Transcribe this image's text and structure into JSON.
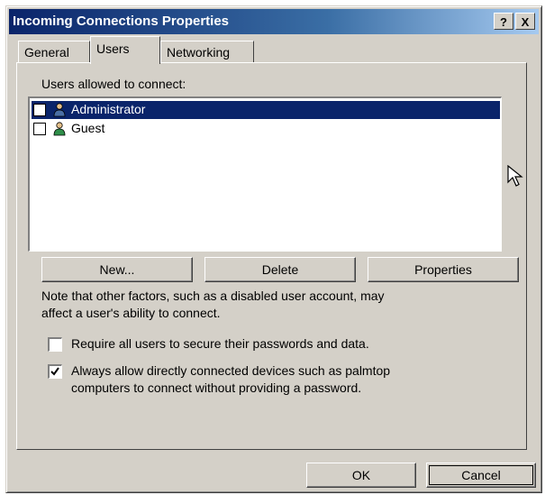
{
  "window": {
    "title": "Incoming Connections Properties",
    "help_label": "?",
    "close_label": "X"
  },
  "tabs": [
    {
      "label": "General"
    },
    {
      "label": "Users"
    },
    {
      "label": "Networking"
    }
  ],
  "users_section": {
    "heading": "Users allowed to connect:",
    "users": [
      {
        "name": "Administrator",
        "checked": false,
        "selected": true
      },
      {
        "name": "Guest",
        "checked": false,
        "selected": false
      }
    ]
  },
  "buttons": {
    "new": "New...",
    "delete": "Delete",
    "properties": "Properties"
  },
  "note": {
    "line1": "Note that other factors, such as a disabled user account, may",
    "line2": "affect a user's ability to connect."
  },
  "options": [
    {
      "line1": "Require all users to secure their passwords and data.",
      "line2": "",
      "checked": false
    },
    {
      "line1": "Always allow directly connected devices such as palmtop",
      "line2": "computers to connect without providing a password.",
      "checked": true
    }
  ],
  "footer": {
    "ok": "OK",
    "cancel": "Cancel"
  },
  "icons": {
    "user": "user-icon",
    "cursor": "mouse-pointer-icon"
  },
  "colors": {
    "titlebar": "#0a246a",
    "selection": "#0a246a",
    "face": "#d4d0c8"
  }
}
